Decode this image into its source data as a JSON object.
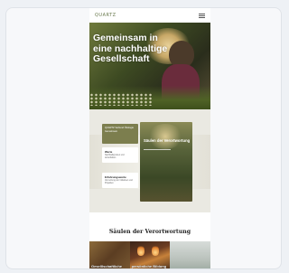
{
  "site": {
    "logo": "QUARTZ",
    "hero_title": "Gemeinsam in eine nachhaltige Gesellschaft"
  },
  "section2": {
    "green_tile_text": "QUARTZ Verbund Ökologie Gemeinsam",
    "tile1_title": "Werte",
    "tile1_text": "Nachhaltig leben und wirtschaften",
    "tile2_title": "Erfahrungswerte",
    "tile2_text": "Vernetzung von Initiativen und Projekten",
    "photo_title": "Säulen der Verortwortung"
  },
  "section3": {
    "title": "Säulen der Verortwortung",
    "pillars": [
      {
        "label": "Geselllschaftliche"
      },
      {
        "label": "persönliche Bildung"
      },
      {
        "label": ""
      }
    ]
  }
}
